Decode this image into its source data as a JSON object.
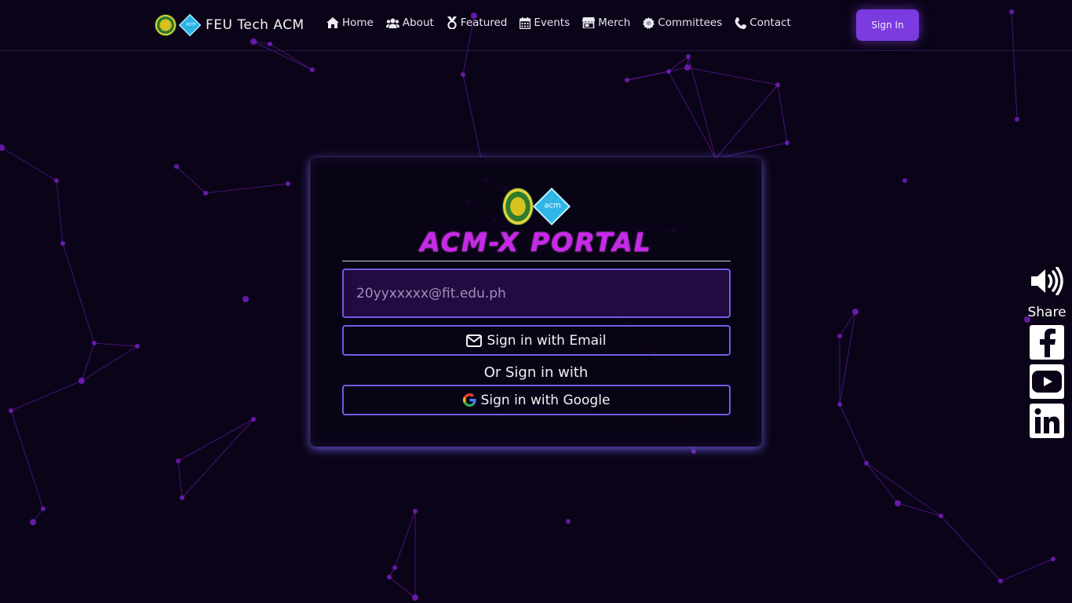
{
  "navbar": {
    "brand_name": "FEU Tech ACM",
    "links": [
      {
        "label": "Home",
        "icon": "home-icon"
      },
      {
        "label": "About",
        "icon": "users-icon"
      },
      {
        "label": "Featured",
        "icon": "medal-icon"
      },
      {
        "label": "Events",
        "icon": "calendar-icon"
      },
      {
        "label": "Merch",
        "icon": "store-icon"
      },
      {
        "label": "Committees",
        "icon": "gear-icon"
      },
      {
        "label": "Contact",
        "icon": "phone-icon"
      }
    ],
    "signin_label": "Sign In"
  },
  "card": {
    "title": "ACM-X PORTAL",
    "email_placeholder": "20yyxxxxx@fit.edu.ph",
    "email_button_label": "Sign in with Email",
    "or_text": "Or Sign in with",
    "google_button_label": "Sign in with Google"
  },
  "side_panel": {
    "share_label": "Share",
    "icons": [
      "volume-icon",
      "facebook-icon",
      "youtube-icon",
      "linkedin-icon"
    ]
  },
  "colors": {
    "background": "#0b0418",
    "accent": "#7a3be0",
    "title": "#c829e8",
    "border": "#6d5de0",
    "network": "#7a1fc8"
  }
}
